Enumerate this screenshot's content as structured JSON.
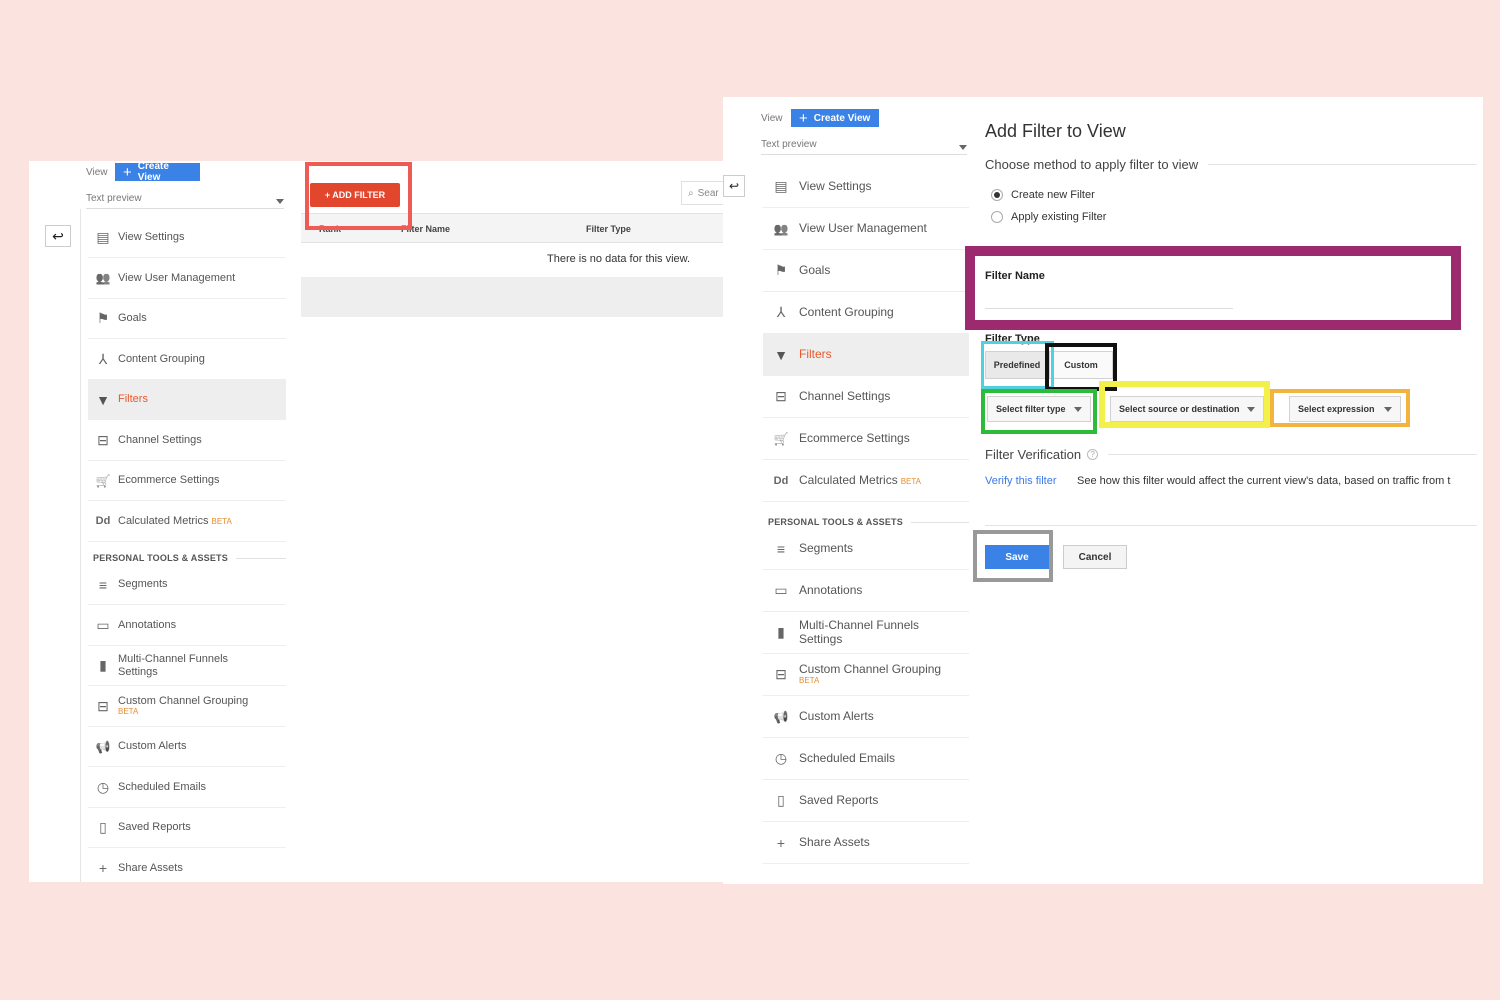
{
  "colors": {
    "background": "#fbe4df",
    "accent_blue": "#3b82e6",
    "add_filter_red": "#e2462c",
    "active_orange": "#e65a2e",
    "beta_orange": "#e58c2e",
    "highlight_red": "#ef5a55",
    "highlight_purple": "#9b2a6f",
    "highlight_cyan": "#4fd1e0",
    "highlight_black": "#111111",
    "highlight_green": "#2dbb3a",
    "highlight_yellow": "#f4f04a",
    "highlight_orange": "#f2b33f",
    "highlight_gray": "#999999"
  },
  "left": {
    "view_label": "View",
    "create_view": "Create View",
    "text_preview": "Text preview",
    "nav": [
      {
        "label": "View Settings",
        "icon": "document-icon"
      },
      {
        "label": "View User Management",
        "icon": "people-icon"
      },
      {
        "label": "Goals",
        "icon": "flag-icon"
      },
      {
        "label": "Content Grouping",
        "icon": "grouping-icon"
      },
      {
        "label": "Filters",
        "icon": "filter-icon",
        "active": true
      },
      {
        "label": "Channel Settings",
        "icon": "channel-icon"
      },
      {
        "label": "Ecommerce Settings",
        "icon": "cart-icon"
      },
      {
        "label": "Calculated Metrics",
        "icon": "dd-icon",
        "badge": "BETA"
      }
    ],
    "section_title": "PERSONAL TOOLS & ASSETS",
    "tools": [
      {
        "label": "Segments",
        "icon": "segments-icon"
      },
      {
        "label": "Annotations",
        "icon": "annotation-icon"
      },
      {
        "label": "Multi-Channel Funnels",
        "line2": "Settings",
        "icon": "bar-chart-icon"
      },
      {
        "label": "Custom Channel Grouping",
        "beta": "BETA",
        "icon": "channel-icon"
      },
      {
        "label": "Custom Alerts",
        "icon": "megaphone-icon"
      },
      {
        "label": "Scheduled Emails",
        "icon": "clock-icon"
      },
      {
        "label": "Saved Reports",
        "icon": "report-icon"
      },
      {
        "label": "Share Assets",
        "icon": "share-icon"
      }
    ],
    "add_filter": "+ ADD FILTER",
    "search_placeholder": "Sear",
    "columns": [
      "Rank",
      "Filter Name",
      "Filter Type"
    ],
    "empty_message": "There is no data for this view."
  },
  "right": {
    "view_label": "View",
    "create_view": "Create View",
    "text_preview": "Text preview",
    "nav": [
      {
        "label": "View Settings",
        "icon": "document-icon"
      },
      {
        "label": "View User Management",
        "icon": "people-icon"
      },
      {
        "label": "Goals",
        "icon": "flag-icon"
      },
      {
        "label": "Content Grouping",
        "icon": "grouping-icon"
      },
      {
        "label": "Filters",
        "icon": "filter-icon",
        "active": true
      },
      {
        "label": "Channel Settings",
        "icon": "channel-icon"
      },
      {
        "label": "Ecommerce Settings",
        "icon": "cart-icon"
      },
      {
        "label": "Calculated Metrics",
        "icon": "dd-icon",
        "badge": "BETA"
      }
    ],
    "section_title": "PERSONAL TOOLS & ASSETS",
    "tools": [
      {
        "label": "Segments",
        "icon": "segments-icon"
      },
      {
        "label": "Annotations",
        "icon": "annotation-icon"
      },
      {
        "label": "Multi-Channel Funnels",
        "line2": "Settings",
        "icon": "bar-chart-icon"
      },
      {
        "label": "Custom Channel Grouping",
        "beta": "BETA",
        "icon": "channel-icon"
      },
      {
        "label": "Custom Alerts",
        "icon": "megaphone-icon"
      },
      {
        "label": "Scheduled Emails",
        "icon": "clock-icon"
      },
      {
        "label": "Saved Reports",
        "icon": "report-icon"
      },
      {
        "label": "Share Assets",
        "icon": "share-icon"
      }
    ],
    "form": {
      "title": "Add Filter to View",
      "method_heading": "Choose method to apply filter to view",
      "option_new": "Create new Filter",
      "option_existing": "Apply existing Filter",
      "filter_name_label": "Filter Name",
      "filter_name_value": "",
      "filter_type_label": "Filter Type",
      "predefined": "Predefined",
      "custom": "Custom",
      "select_filter_type": "Select filter type",
      "select_source": "Select source or destination",
      "select_expression": "Select expression",
      "verification_heading": "Filter Verification",
      "verify_link": "Verify this filter",
      "verify_desc": "See how this filter would affect the current view's data, based on traffic from t",
      "save": "Save",
      "cancel": "Cancel"
    }
  }
}
